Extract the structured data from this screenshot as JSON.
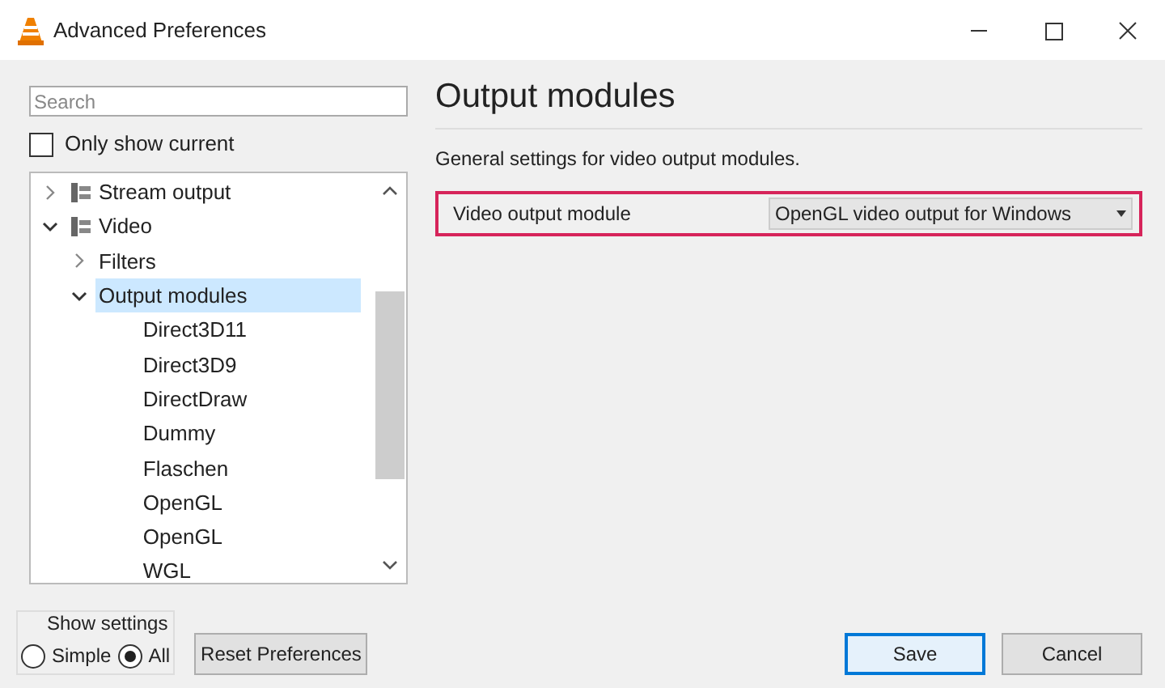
{
  "window": {
    "title": "Advanced Preferences"
  },
  "search": {
    "placeholder": "Search"
  },
  "only_show_current": {
    "label": "Only show current",
    "checked": false
  },
  "tree": [
    {
      "label": "Stream output",
      "expanded": false,
      "selected": false
    },
    {
      "label": "Video",
      "expanded": true,
      "selected": false,
      "children": [
        {
          "label": "Filters",
          "expanded": false,
          "selected": false
        },
        {
          "label": "Output modules",
          "expanded": true,
          "selected": true,
          "children": [
            {
              "label": "Direct3D11",
              "selected": false
            },
            {
              "label": "Direct3D9",
              "selected": false
            },
            {
              "label": "DirectDraw",
              "selected": false
            },
            {
              "label": "Dummy",
              "selected": false
            },
            {
              "label": "Flaschen",
              "selected": false
            },
            {
              "label": "OpenGL",
              "selected": false
            },
            {
              "label": "OpenGL",
              "selected": false
            },
            {
              "label": "WGL",
              "selected": false
            }
          ]
        }
      ]
    }
  ],
  "show_settings": {
    "label": "Show settings",
    "options": [
      {
        "label": "Simple",
        "selected": false
      },
      {
        "label": "All",
        "selected": true
      }
    ]
  },
  "reset_button": "Reset Preferences",
  "panel": {
    "title": "Output modules",
    "description": "General settings for video output modules.",
    "setting": {
      "label": "Video output module",
      "value": "OpenGL video output for Windows",
      "highlighted": true
    }
  },
  "buttons": [
    {
      "label": "Save",
      "default": true
    },
    {
      "label": "Cancel",
      "default": false
    }
  ]
}
